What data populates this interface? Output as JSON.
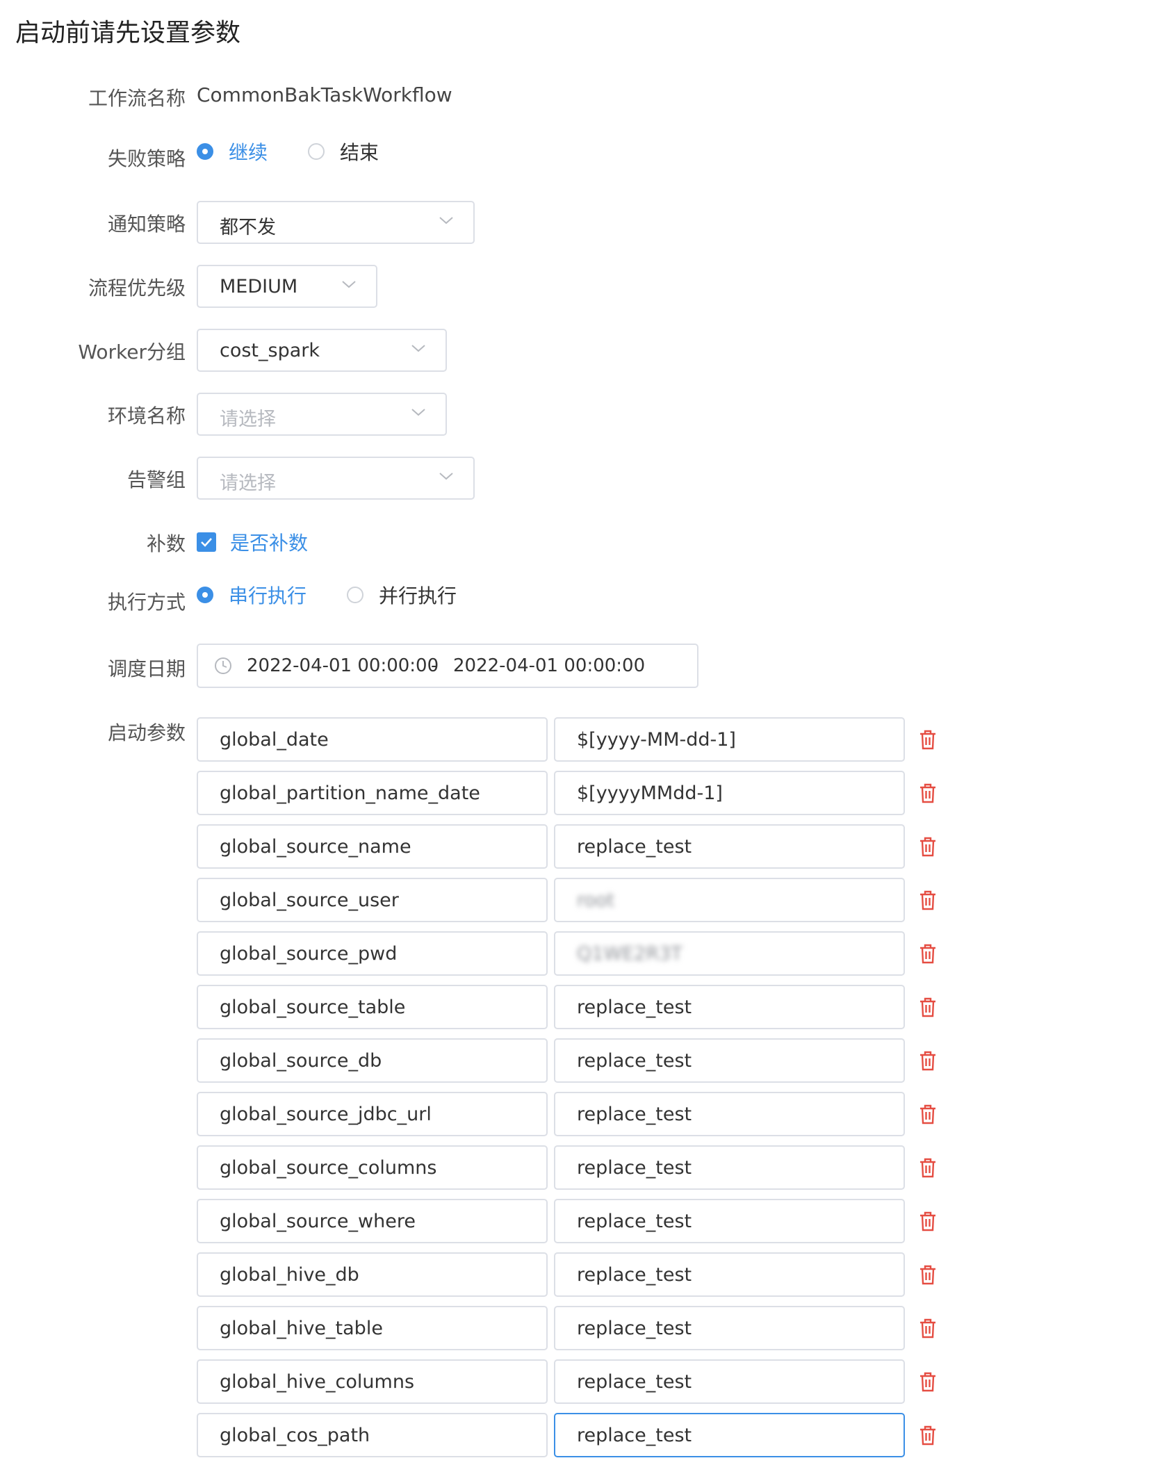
{
  "page_title": "启动前请先设置参数",
  "workflow": {
    "label": "工作流名称",
    "value": "CommonBakTaskWorkflow"
  },
  "failure_strategy": {
    "label": "失败策略",
    "options": [
      {
        "label": "继续",
        "checked": true
      },
      {
        "label": "结束",
        "checked": false
      }
    ]
  },
  "notify_strategy": {
    "label": "通知策略",
    "value": "都不发"
  },
  "priority": {
    "label": "流程优先级",
    "value": "MEDIUM"
  },
  "worker_group": {
    "label": "Worker分组",
    "value": "cost_spark"
  },
  "environment": {
    "label": "环境名称",
    "placeholder": "请选择"
  },
  "alarm_group": {
    "label": "告警组",
    "placeholder": "请选择"
  },
  "complement": {
    "label": "补数",
    "checkbox_label": "是否补数",
    "checked": true
  },
  "run_mode": {
    "label": "执行方式",
    "options": [
      {
        "label": "串行执行",
        "checked": true
      },
      {
        "label": "并行执行",
        "checked": false
      }
    ]
  },
  "schedule_date": {
    "label": "调度日期",
    "start": "2022-04-01 00:00:00",
    "separator": "-",
    "end": "2022-04-01 00:00:00"
  },
  "startup_params": {
    "label": "启动参数",
    "rows": [
      {
        "key": "global_date",
        "value": "$[yyyy-MM-dd-1]"
      },
      {
        "key": "global_partition_name_date",
        "value": "$[yyyyMMdd-1]"
      },
      {
        "key": "global_source_name",
        "value": "replace_test"
      },
      {
        "key": "global_source_user",
        "value": "root",
        "blurred": true
      },
      {
        "key": "global_source_pwd",
        "value": "Q1WE2R3T",
        "blurred": true
      },
      {
        "key": "global_source_table",
        "value": "replace_test"
      },
      {
        "key": "global_source_db",
        "value": "replace_test"
      },
      {
        "key": "global_source_jdbc_url",
        "value": "replace_test"
      },
      {
        "key": "global_source_columns",
        "value": "replace_test"
      },
      {
        "key": "global_source_where",
        "value": "replace_test"
      },
      {
        "key": "global_hive_db",
        "value": "replace_test"
      },
      {
        "key": "global_hive_table",
        "value": "replace_test"
      },
      {
        "key": "global_hive_columns",
        "value": "replace_test"
      },
      {
        "key": "global_cos_path",
        "value": "replace_test",
        "focused": true
      }
    ]
  },
  "colors": {
    "accent": "#3b8fe6",
    "border": "#dcdfe6",
    "danger": "#e54d42",
    "placeholder": "#b6b9bf"
  }
}
